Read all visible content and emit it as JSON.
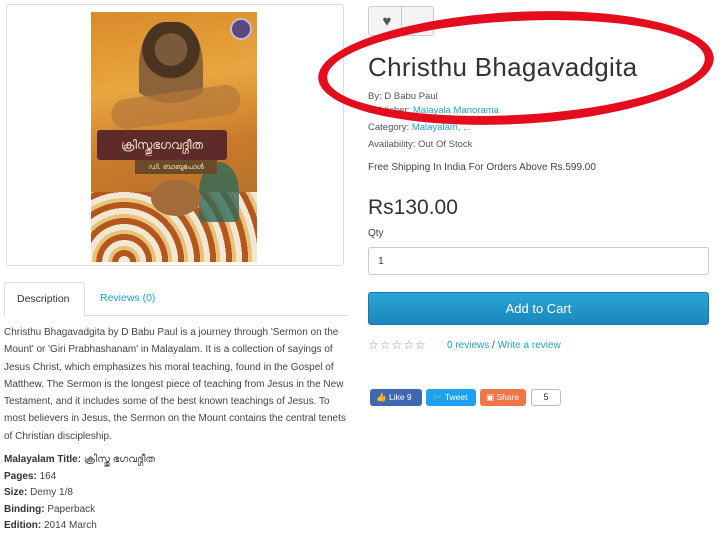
{
  "product": {
    "title": "Christhu Bhagavadgita",
    "by_label": "By:",
    "author": "D Babu Paul",
    "publisher_label": "Publisher:",
    "publisher": "Malayala Manorama",
    "category_label": "Category:",
    "category": "Malayalam, ...",
    "availability_label": "Availability:",
    "availability": "Out Of Stock",
    "shipping_note": "Free Shipping In India For Orders Above Rs.599.00",
    "price": "Rs130.00",
    "qty_label": "Qty",
    "qty_value": "1",
    "add_to_cart": "Add to Cart"
  },
  "cover": {
    "title_text": "ക്രിസ്തുഭഗവദ്ഗീത",
    "author_text": "ഡി. ബാബുപോൾ"
  },
  "reviews": {
    "stars": "☆☆☆☆☆",
    "count_link": "0 reviews",
    "separator": " / ",
    "write_link": "Write a review"
  },
  "social": {
    "like": "Like 9",
    "tweet": "Tweet",
    "share": "Share",
    "share_count": "5"
  },
  "tabs": [
    {
      "label": "Description"
    },
    {
      "label": "Reviews (0)"
    }
  ],
  "description": "Christhu Bhagavadgita by D Babu Paul is a journey through 'Sermon on the Mount' or 'Giri Prabhashanam' in Malayalam. It is a collection of sayings of Jesus Christ, which emphasizes his moral teaching, found in the Gospel of Matthew. The Sermon is the longest piece of teaching from Jesus in the New Testament, and it includes some of the best known teachings of Jesus. To most believers in Jesus, the Sermon on the Mount contains the central tenets of Christian discipleship.",
  "specs": [
    {
      "label": "Malayalam Title:",
      "value": "ക്രിസ്തു ഭഗവദ്ഗീത"
    },
    {
      "label": "Pages:",
      "value": "164"
    },
    {
      "label": "Size:",
      "value": "Demy 1/8"
    },
    {
      "label": "Binding:",
      "value": "Paperback"
    },
    {
      "label": "Edition:",
      "value": "2014 March"
    }
  ],
  "colors": {
    "accent": "#23a1d1",
    "annotation_circle": "#e30d1e"
  }
}
